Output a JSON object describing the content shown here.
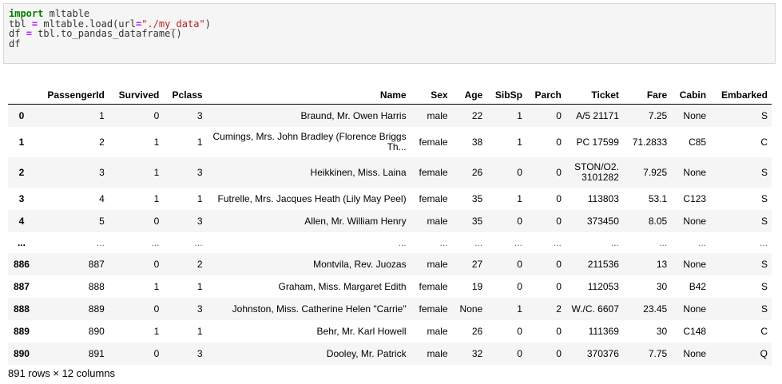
{
  "code": {
    "lines": [
      [
        {
          "t": "import",
          "c": "kw"
        },
        {
          "t": " mltable",
          "c": ""
        }
      ],
      [
        {
          "t": "tbl ",
          "c": ""
        },
        {
          "t": "=",
          "c": "op"
        },
        {
          "t": " mltable.load(url",
          "c": ""
        },
        {
          "t": "=",
          "c": "op"
        },
        {
          "t": "\"./my_data\"",
          "c": "str"
        },
        {
          "t": ")",
          "c": ""
        }
      ],
      [
        {
          "t": "df ",
          "c": ""
        },
        {
          "t": "=",
          "c": "op"
        },
        {
          "t": " tbl.to_pandas_dataframe()",
          "c": ""
        }
      ],
      [
        {
          "t": "df",
          "c": ""
        }
      ]
    ]
  },
  "table": {
    "columns": [
      "",
      "PassengerId",
      "Survived",
      "Pclass",
      "Name",
      "Sex",
      "Age",
      "SibSp",
      "Parch",
      "Ticket",
      "Fare",
      "Cabin",
      "Embarked"
    ],
    "rows": [
      {
        "h": "h28",
        "cells": [
          "0",
          "1",
          "0",
          "3",
          "Braund, Mr. Owen Harris",
          "male",
          "22",
          "1",
          "0",
          "A/5 21171",
          "7.25",
          "None",
          "S"
        ]
      },
      {
        "h": "h38",
        "wrapName": true,
        "cells": [
          "1",
          "2",
          "1",
          "1",
          "Cumings, Mrs. John Bradley (Florence Briggs Th...",
          "female",
          "38",
          "1",
          "0",
          "PC 17599",
          "71.2833",
          "C85",
          "C"
        ]
      },
      {
        "h": "h38",
        "wrapTicket": true,
        "cells": [
          "2",
          "3",
          "1",
          "3",
          "Heikkinen, Miss. Laina",
          "female",
          "26",
          "0",
          "0",
          "STON/O2. 3101282",
          "7.925",
          "None",
          "S"
        ]
      },
      {
        "h": "h28",
        "cells": [
          "3",
          "4",
          "1",
          "1",
          "Futrelle, Mrs. Jacques Heath (Lily May Peel)",
          "female",
          "35",
          "1",
          "0",
          "113803",
          "53.1",
          "C123",
          "S"
        ]
      },
      {
        "h": "h28",
        "cells": [
          "4",
          "5",
          "0",
          "3",
          "Allen, Mr. William Henry",
          "male",
          "35",
          "0",
          "0",
          "373450",
          "8.05",
          "None",
          "S"
        ]
      },
      {
        "h": "h26",
        "ellipsis": true,
        "cells": [
          "...",
          "...",
          "...",
          "...",
          "...",
          "...",
          "...",
          "...",
          "...",
          "...",
          "...",
          "...",
          "..."
        ]
      },
      {
        "h": "h28",
        "cells": [
          "886",
          "887",
          "0",
          "2",
          "Montvila, Rev. Juozas",
          "male",
          "27",
          "0",
          "0",
          "211536",
          "13",
          "None",
          "S"
        ]
      },
      {
        "h": "h28",
        "cells": [
          "887",
          "888",
          "1",
          "1",
          "Graham, Miss. Margaret Edith",
          "female",
          "19",
          "0",
          "0",
          "112053",
          "30",
          "B42",
          "S"
        ]
      },
      {
        "h": "h28",
        "cells": [
          "888",
          "889",
          "0",
          "3",
          "Johnston, Miss. Catherine Helen \"Carrie\"",
          "female",
          "None",
          "1",
          "2",
          "W./C. 6607",
          "23.45",
          "None",
          "S"
        ]
      },
      {
        "h": "h28",
        "cells": [
          "889",
          "890",
          "1",
          "1",
          "Behr, Mr. Karl Howell",
          "male",
          "26",
          "0",
          "0",
          "111369",
          "30",
          "C148",
          "C"
        ]
      },
      {
        "h": "h28",
        "cells": [
          "890",
          "891",
          "0",
          "3",
          "Dooley, Mr. Patrick",
          "male",
          "32",
          "0",
          "0",
          "370376",
          "7.75",
          "None",
          "Q"
        ]
      }
    ]
  },
  "footer": {
    "shape": "891 rows × 12 columns"
  }
}
